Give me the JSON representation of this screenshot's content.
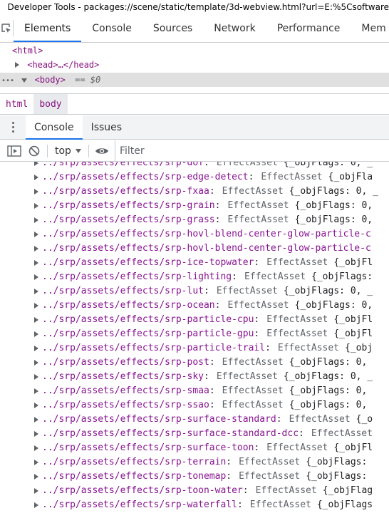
{
  "window": {
    "title": "Developer Tools - packages://scene/static/template/3d-webview.html?url=E:%5Csoftware"
  },
  "main_tabs": [
    {
      "label": "Elements",
      "active": true
    },
    {
      "label": "Console",
      "active": false
    },
    {
      "label": "Sources",
      "active": false
    },
    {
      "label": "Network",
      "active": false
    },
    {
      "label": "Performance",
      "active": false
    },
    {
      "label": "Mem",
      "active": false
    }
  ],
  "dom_tree": {
    "html": "<html>",
    "head": "<head>…</head>",
    "body": "<body>",
    "body_suffix": "== $0",
    "ellipsis": "•••"
  },
  "breadcrumbs": [
    {
      "label": "html",
      "active": false
    },
    {
      "label": "body",
      "active": true
    }
  ],
  "drawer_tabs": [
    {
      "label": "Console",
      "active": true
    },
    {
      "label": "Issues",
      "active": false
    }
  ],
  "console_toolbar": {
    "context": "top",
    "filter_placeholder": "Filter"
  },
  "icons": {
    "inspect": "inspect-element-icon",
    "drawer_menu": "kebab-menu-icon",
    "sidebar": "sidebar-toggle-icon",
    "clear": "clear-console-icon",
    "eye": "live-expression-eye-icon",
    "dropdown": "dropdown-arrow-icon",
    "expand": "expand-triangle-icon"
  },
  "colors": {
    "accent": "#1a73e8",
    "path": "#881391",
    "tag": "#881280"
  },
  "console_logs": [
    {
      "path": "../srp/assets/effects/srp-dof",
      "type": "EffectAsset",
      "obj": "{_objFlags: 0, _"
    },
    {
      "path": "../srp/assets/effects/srp-edge-detect",
      "type": "EffectAsset",
      "obj": "{_objFla"
    },
    {
      "path": "../srp/assets/effects/srp-fxaa",
      "type": "EffectAsset",
      "obj": "{_objFlags: 0, _"
    },
    {
      "path": "../srp/assets/effects/srp-grain",
      "type": "EffectAsset",
      "obj": "{_objFlags: 0,"
    },
    {
      "path": "../srp/assets/effects/srp-grass",
      "type": "EffectAsset",
      "obj": "{_objFlags: 0,"
    },
    {
      "path": "../srp/assets/effects/srp-hovl-blend-center-glow-particle-c",
      "type": "",
      "obj": ""
    },
    {
      "path": "../srp/assets/effects/srp-hovl-blend-center-glow-particle-c",
      "type": "",
      "obj": ""
    },
    {
      "path": "../srp/assets/effects/srp-ice-topwater",
      "type": "EffectAsset",
      "obj": "{_objFl"
    },
    {
      "path": "../srp/assets/effects/srp-lighting",
      "type": "EffectAsset",
      "obj": "{_objFlags:"
    },
    {
      "path": "../srp/assets/effects/srp-lut",
      "type": "EffectAsset",
      "obj": "{_objFlags: 0, _"
    },
    {
      "path": "../srp/assets/effects/srp-ocean",
      "type": "EffectAsset",
      "obj": "{_objFlags: 0,"
    },
    {
      "path": "../srp/assets/effects/srp-particle-cpu",
      "type": "EffectAsset",
      "obj": "{_objFl"
    },
    {
      "path": "../srp/assets/effects/srp-particle-gpu",
      "type": "EffectAsset",
      "obj": "{_objFl"
    },
    {
      "path": "../srp/assets/effects/srp-particle-trail",
      "type": "EffectAsset",
      "obj": "{_obj"
    },
    {
      "path": "../srp/assets/effects/srp-post",
      "type": "EffectAsset",
      "obj": "{_objFlags: 0,"
    },
    {
      "path": "../srp/assets/effects/srp-sky",
      "type": "EffectAsset",
      "obj": "{_objFlags: 0, _"
    },
    {
      "path": "../srp/assets/effects/srp-smaa",
      "type": "EffectAsset",
      "obj": "{_objFlags: 0,"
    },
    {
      "path": "../srp/assets/effects/srp-ssao",
      "type": "EffectAsset",
      "obj": "{_objFlags: 0,"
    },
    {
      "path": "../srp/assets/effects/srp-surface-standard",
      "type": "EffectAsset",
      "obj": "{_o"
    },
    {
      "path": "../srp/assets/effects/srp-surface-standard-dcc",
      "type": "EffectAsset",
      "obj": ""
    },
    {
      "path": "../srp/assets/effects/srp-surface-toon",
      "type": "EffectAsset",
      "obj": "{_objFl"
    },
    {
      "path": "../srp/assets/effects/srp-terrain",
      "type": "EffectAsset",
      "obj": "{_objFlags:"
    },
    {
      "path": "../srp/assets/effects/srp-tonemap",
      "type": "EffectAsset",
      "obj": "{_objFlags:"
    },
    {
      "path": "../srp/assets/effects/srp-toon-water",
      "type": "EffectAsset",
      "obj": "{_objFlag"
    },
    {
      "path": "../srp/assets/effects/srp-waterfall",
      "type": "EffectAsset",
      "obj": "{_objFlags"
    }
  ]
}
